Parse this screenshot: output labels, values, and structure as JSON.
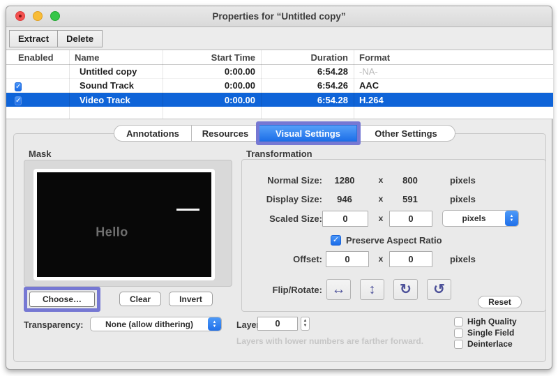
{
  "window": {
    "title": "Properties for “Untitled copy”"
  },
  "toolbar": {
    "extract": "Extract",
    "delete": "Delete"
  },
  "track_table": {
    "columns": {
      "enabled": "Enabled",
      "name": "Name",
      "start": "Start Time",
      "duration": "Duration",
      "format": "Format"
    },
    "rows": [
      {
        "enabled": false,
        "name": "Untitled copy",
        "start": "0:00.00",
        "duration": "6:54.28",
        "format": "-NA-",
        "selected": false
      },
      {
        "enabled": true,
        "name": "Sound Track",
        "start": "0:00.00",
        "duration": "6:54.26",
        "format": "AAC",
        "selected": false
      },
      {
        "enabled": true,
        "name": "Video Track",
        "start": "0:00.00",
        "duration": "6:54.28",
        "format": "H.264",
        "selected": true
      }
    ]
  },
  "tabs": [
    {
      "label": "Annotations",
      "selected": false
    },
    {
      "label": "Resources",
      "selected": false
    },
    {
      "label": "Visual Settings",
      "selected": true,
      "highlighted": true
    },
    {
      "label": "Other Settings",
      "selected": false
    }
  ],
  "mask": {
    "label": "Mask",
    "preview_text": "Hello",
    "choose": "Choose…",
    "clear": "Clear",
    "invert": "Invert",
    "choose_highlighted": true
  },
  "transparency": {
    "label": "Transparency:",
    "value": "None (allow dithering)"
  },
  "transformation": {
    "label": "Transformation",
    "sep": "x",
    "normal_size": {
      "label": "Normal Size:",
      "w": "1280",
      "h": "800",
      "unit": "pixels"
    },
    "display_size": {
      "label": "Display Size:",
      "w": "946",
      "h": "591",
      "unit": "pixels"
    },
    "scaled_size": {
      "label": "Scaled Size:",
      "w": "0",
      "h": "0",
      "unit": "pixels"
    },
    "preserve_aspect_ratio": {
      "label": "Preserve Aspect Ratio",
      "checked": true
    },
    "offset": {
      "label": "Offset:",
      "x_val": "0",
      "y_val": "0",
      "unit": "pixels"
    },
    "flip_rotate": {
      "label": "Flip/Rotate:"
    },
    "reset": "Reset",
    "check_glyph": "✓"
  },
  "layer": {
    "label": "Layer:",
    "value": "0",
    "hint": "Layers with lower numbers are farther forward."
  },
  "quality_options": [
    {
      "label": "High Quality",
      "checked": false
    },
    {
      "label": "Single Field",
      "checked": false
    },
    {
      "label": "Deinterlace",
      "checked": false
    }
  ],
  "icons": {
    "flip_horizontal": "↔",
    "flip_vertical": "↕",
    "rotate_cw": "↻",
    "rotate_ccw": "↺",
    "stepper_up": "▲",
    "stepper_down": "▼"
  },
  "colors": {
    "selection_blue": "#0f64d8",
    "tab_selected_blue": "#1d6fe8",
    "highlight_purple": "#7678d3",
    "flip_icon_indigo": "#4d5199",
    "checkbox_blue": "#1a6be8",
    "window_bg": "#ececec"
  }
}
